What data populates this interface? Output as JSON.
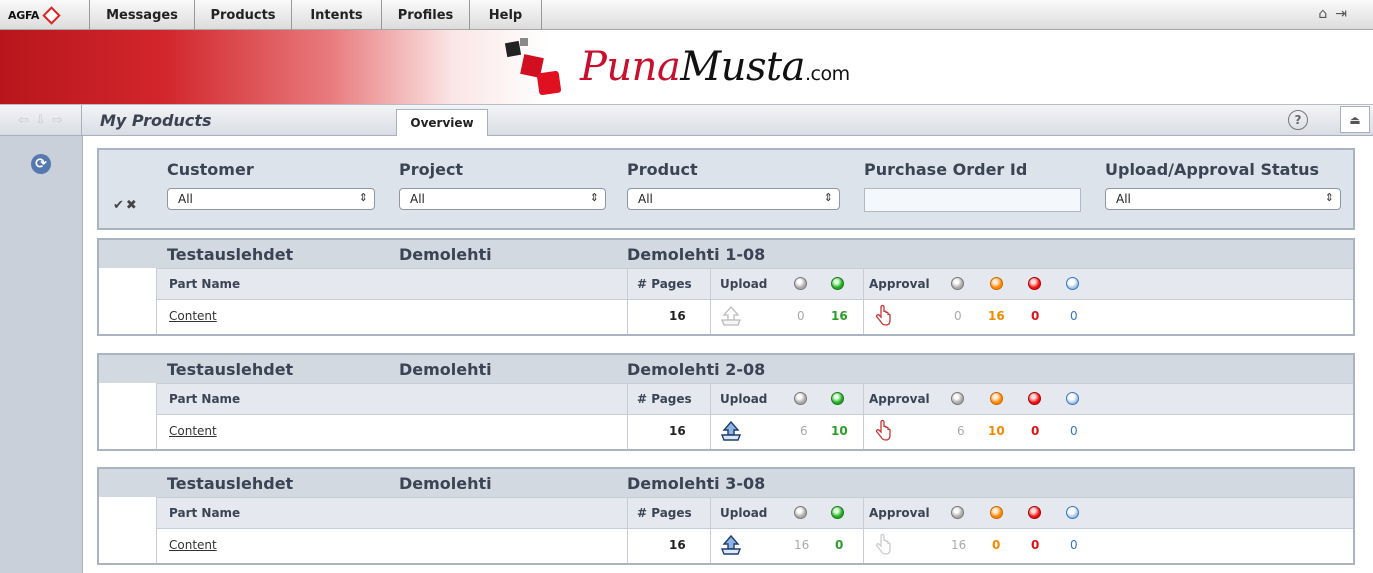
{
  "menubar": {
    "brand": "AGFA",
    "items": [
      "Messages",
      "Products",
      "Intents",
      "Profiles",
      "Help"
    ]
  },
  "icons": {
    "home": "home-icon",
    "logout": "logout-icon",
    "refresh": "refresh-icon",
    "help": "help-icon",
    "eject": "eject-icon",
    "upload": "upload-icon",
    "approval": "approval-hand-icon"
  },
  "banner": {
    "brand_part1": "Puna",
    "brand_part2": "Musta",
    "brand_domain": ".com"
  },
  "toolbar": {
    "title": "My Products",
    "tab": "Overview",
    "help_glyph": "?",
    "eject_glyph": "⏏"
  },
  "filters": {
    "headers": {
      "customer": "Customer",
      "project": "Project",
      "product": "Product",
      "po": "Purchase Order Id",
      "status": "Upload/Approval Status"
    },
    "customer_value": "All",
    "project_value": "All",
    "product_value": "All",
    "po_value": "",
    "status_value": "All"
  },
  "columns": {
    "part_name": "Part Name",
    "pages": "# Pages",
    "upload": "Upload",
    "approval": "Approval"
  },
  "colors": {
    "green": "#2a9d2a",
    "orange": "#f08a00",
    "red": "#e01010",
    "blue": "#3576c7"
  },
  "blocks": [
    {
      "customer": "Testauslehdet",
      "project": "Demolehti",
      "product": "Demolehti 1-08",
      "part": "Content",
      "pages": "16",
      "upload_gray": "0",
      "upload_green": "16",
      "appr_gray": "0",
      "appr_orange": "16",
      "appr_red": "0",
      "appr_blue": "0"
    },
    {
      "customer": "Testauslehdet",
      "project": "Demolehti",
      "product": "Demolehti 2-08",
      "part": "Content",
      "pages": "16",
      "upload_gray": "6",
      "upload_green": "10",
      "appr_gray": "6",
      "appr_orange": "10",
      "appr_red": "0",
      "appr_blue": "0"
    },
    {
      "customer": "Testauslehdet",
      "project": "Demolehti",
      "product": "Demolehti 3-08",
      "part": "Content",
      "pages": "16",
      "upload_gray": "16",
      "upload_green": "0",
      "appr_gray": "16",
      "appr_orange": "0",
      "appr_red": "0",
      "appr_blue": "0"
    }
  ]
}
